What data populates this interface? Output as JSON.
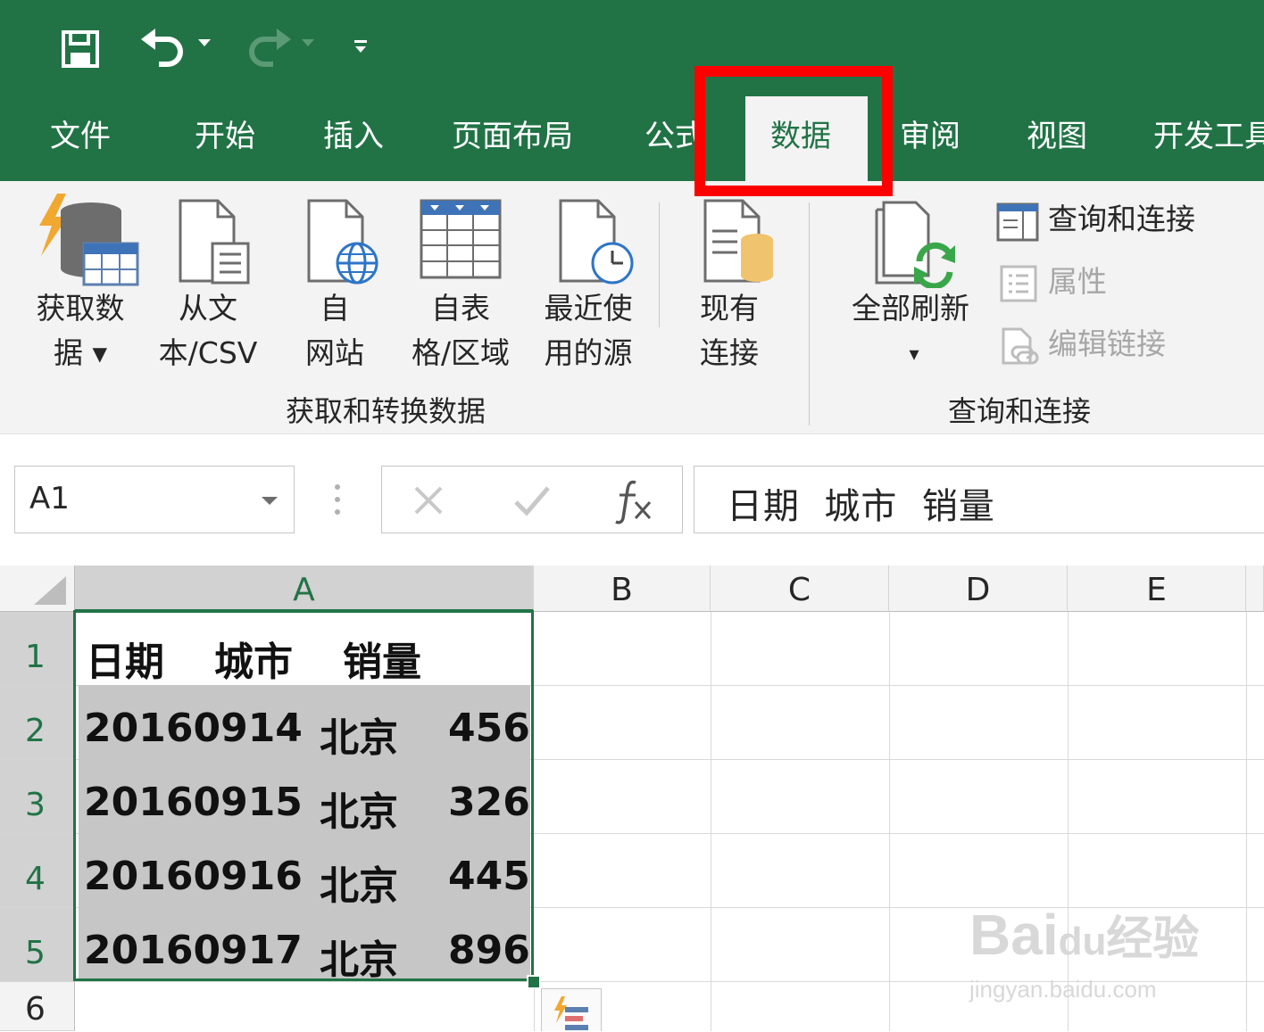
{
  "ribbon_tabs": [
    "文件",
    "开始",
    "插入",
    "页面布局",
    "公式",
    "数据",
    "审阅",
    "视图",
    "开发工具"
  ],
  "active_tab": "数据",
  "ribbon": {
    "get_transform": {
      "buttons": [
        {
          "line1": "获取数",
          "line2": "据 ▾",
          "icon": "database-icon"
        },
        {
          "line1": "从文",
          "line2": "本/CSV",
          "icon": "text-file-icon"
        },
        {
          "line1": "自",
          "line2": "网站",
          "icon": "web-icon"
        },
        {
          "line1": "自表",
          "line2": "格/区域",
          "icon": "table-icon"
        },
        {
          "line1": "最近使",
          "line2": "用的源",
          "icon": "recent-source-icon"
        },
        {
          "line1": "现有",
          "line2": "连接",
          "icon": "existing-connections-icon"
        }
      ],
      "group_label": "获取和转换数据"
    },
    "queries": {
      "refresh_label": "全部刷新",
      "refresh_dropdown": "▾",
      "queries_connections": "查询和连接",
      "properties": "属性",
      "edit_links": "编辑链接",
      "group_label": "查询和连接"
    }
  },
  "formula_bar": {
    "name_box": "A1",
    "formula": "日期  城市  销量"
  },
  "columns": [
    "A",
    "B",
    "C",
    "D",
    "E"
  ],
  "rows": [
    {
      "num": "1",
      "date": "日期",
      "city": "城市",
      "sales": "销量"
    },
    {
      "num": "2",
      "date": "20160914",
      "city": "北京",
      "sales": "456"
    },
    {
      "num": "3",
      "date": "20160915",
      "city": "北京",
      "sales": "326"
    },
    {
      "num": "4",
      "date": "20160916",
      "city": "北京",
      "sales": "445"
    },
    {
      "num": "5",
      "date": "20160917",
      "city": "北京",
      "sales": "896"
    },
    {
      "num": "6",
      "date": "",
      "city": "",
      "sales": ""
    }
  ],
  "watermark": {
    "brand": "Bai",
    "brand2": "du",
    "cn": "经验",
    "url": "jingyan.baidu.com"
  },
  "colors": {
    "excel_green": "#217346",
    "highlight": "#ff0000",
    "selection_fill": "#c6c6c6"
  }
}
